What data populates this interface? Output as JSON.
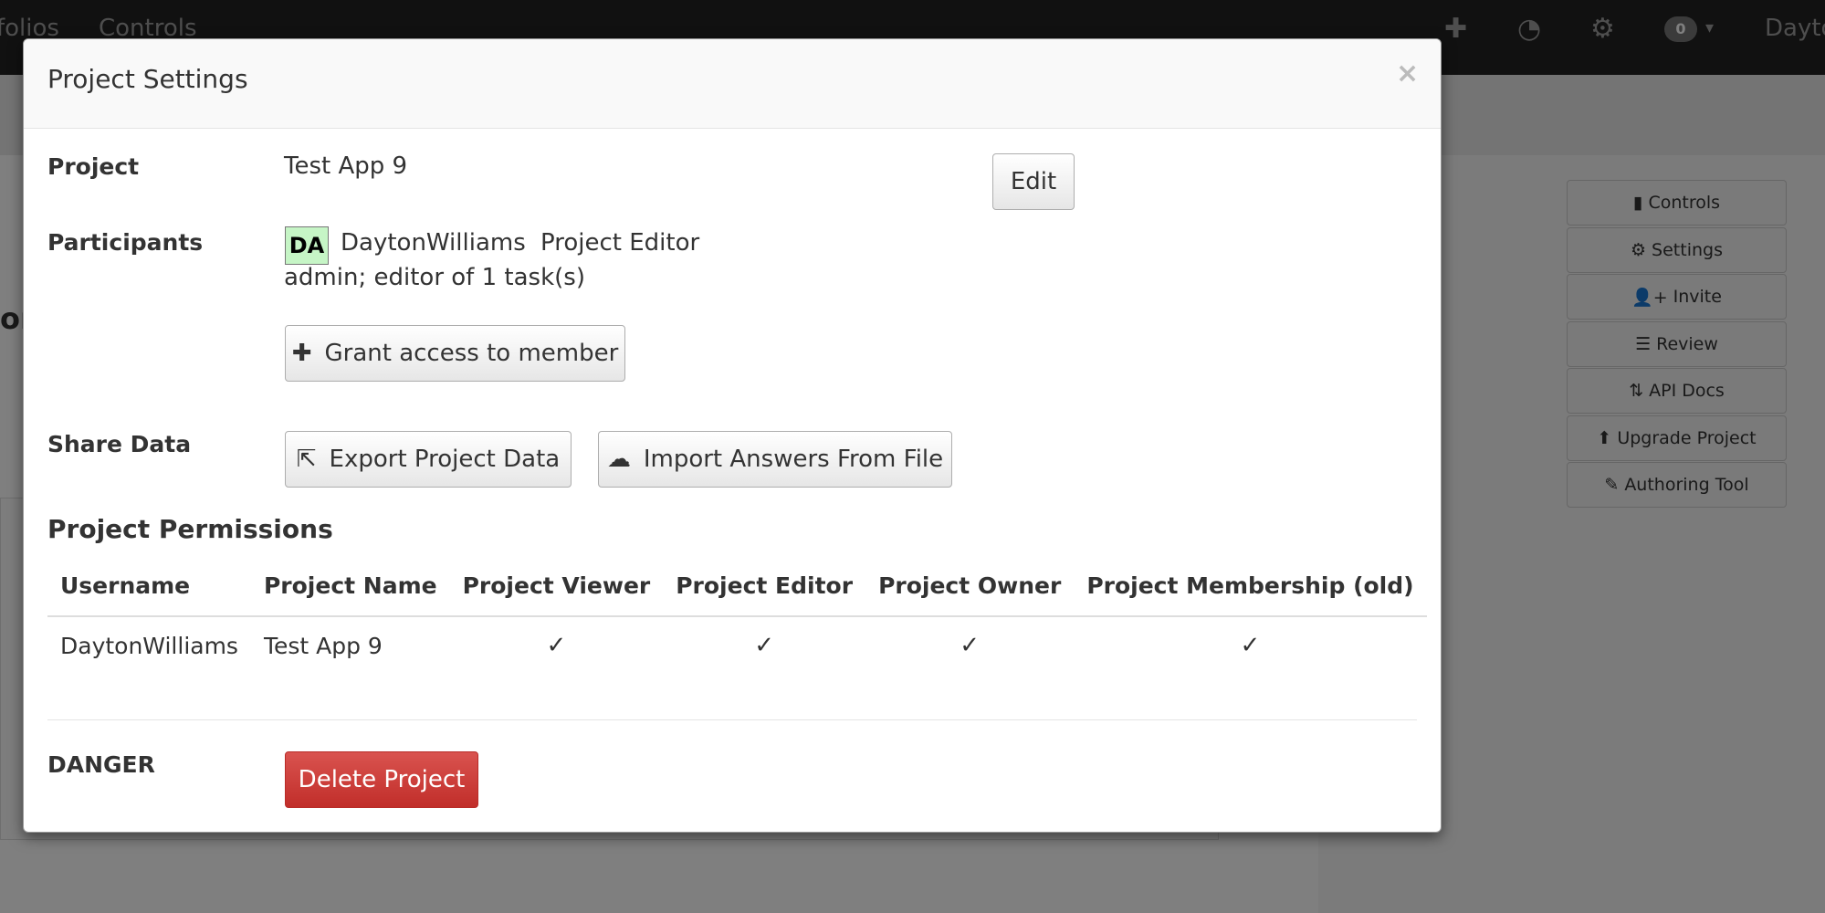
{
  "nav": {
    "items": [
      "folios",
      "Controls"
    ],
    "badge_count": "0",
    "user": "Dayto"
  },
  "background": {
    "title": "or"
  },
  "sidebar": {
    "buttons": [
      {
        "icon": "book-icon",
        "glyph": "▮",
        "label": "Controls"
      },
      {
        "icon": "gear-icon",
        "glyph": "⚙",
        "label": "Settings"
      },
      {
        "icon": "add-user-icon",
        "glyph": "👤+",
        "label": "Invite"
      },
      {
        "icon": "list-icon",
        "glyph": "☰",
        "label": "Review"
      },
      {
        "icon": "sort-icon",
        "glyph": "⇅",
        "label": "API Docs"
      },
      {
        "icon": "upload-circle-icon",
        "glyph": "⬆",
        "label": "Upgrade Project"
      },
      {
        "icon": "pencil-icon",
        "glyph": "✎",
        "label": "Authoring Tool"
      }
    ]
  },
  "modal": {
    "title": "Project Settings",
    "close": "×",
    "project_label": "Project",
    "project_name": "Test App 9",
    "edit_label": "Edit",
    "participants_label": "Participants",
    "participant": {
      "initials": "DA",
      "username": "DaytonWilliams",
      "role": "Project Editor",
      "detail": "admin; editor of 1 task(s)"
    },
    "grant_label": "Grant access to member",
    "share_label": "Share Data",
    "export_label": "Export Project Data",
    "import_label": "Import Answers From File",
    "permissions_title": "Project Permissions",
    "table": {
      "headers": [
        "Username",
        "Project Name",
        "Project Viewer",
        "Project Editor",
        "Project Owner",
        "Project Membership (old)"
      ],
      "rows": [
        [
          "DaytonWilliams",
          "Test App 9",
          "✓",
          "✓",
          "✓",
          "✓"
        ]
      ]
    },
    "danger_label": "DANGER",
    "delete_label": "Delete Project"
  },
  "colors": {
    "navbar": "#222222",
    "danger": "#d9534f",
    "avatar_bg": "#c6f5c6"
  }
}
